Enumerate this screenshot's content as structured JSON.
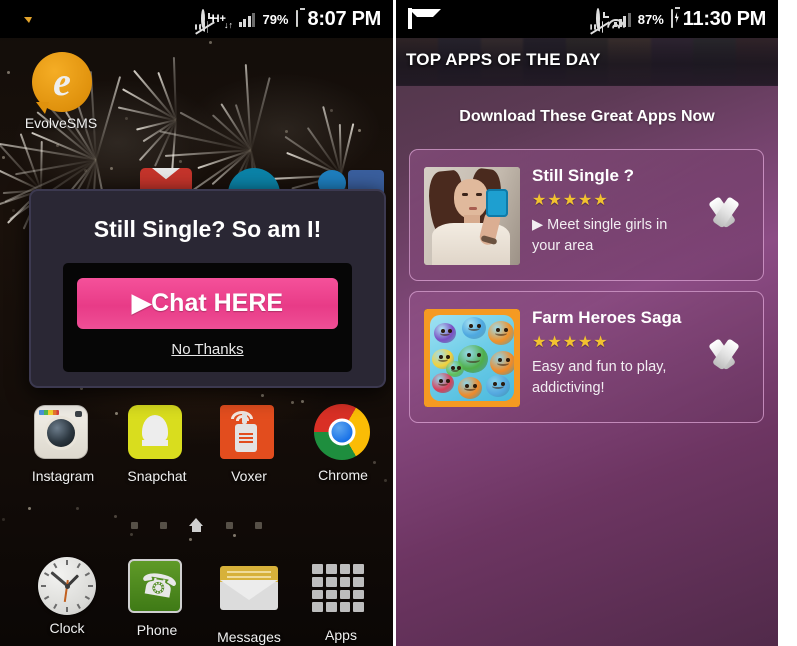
{
  "left_phone": {
    "statusbar": {
      "icons_left": [
        "snapchat-ghost-icon",
        "chat-bubble-icon"
      ],
      "icons_right": [
        "vibrate-mute-icon",
        "alarm-icon",
        "hplus-data-icon",
        "signal-bars-icon"
      ],
      "data_label": "H+",
      "data_arrows": "↓↑",
      "battery_percent": "79%",
      "time": "8:07 PM"
    },
    "home_icons": [
      {
        "label": "EvolveSMS",
        "icon": "evolvesms-icon"
      },
      {
        "label": "Instagram",
        "icon": "instagram-icon"
      },
      {
        "label": "Snapchat",
        "icon": "snapchat-icon"
      },
      {
        "label": "Voxer",
        "icon": "voxer-icon"
      },
      {
        "label": "Chrome",
        "icon": "chrome-icon"
      }
    ],
    "dock": [
      {
        "label": "Clock",
        "icon": "clock-icon"
      },
      {
        "label": "Phone",
        "icon": "phone-icon"
      },
      {
        "label": "Messages",
        "icon": "messages-icon"
      },
      {
        "label": "Apps",
        "icon": "apps-grid-icon"
      }
    ],
    "page_indicator": {
      "pages": 5,
      "current": 3,
      "home_icon": "home-icon"
    },
    "dialog": {
      "title": "Still Single? So am I!",
      "primary_button": "▶Chat HERE",
      "dismiss_link": "No Thanks",
      "accent_color": "#ef4f96",
      "panel_color": "#2a2734"
    }
  },
  "right_phone": {
    "statusbar": {
      "icons_left": [
        "envelope-icon",
        "circle-q-icon"
      ],
      "icons_right": [
        "vibrate-mute-icon",
        "alarm-icon",
        "wifi-icon",
        "signal-bars-icon"
      ],
      "battery_percent": "87%",
      "battery_state": "charging",
      "time": "11:30 PM"
    },
    "ad": {
      "header_title": "TOP APPS OF THE DAY",
      "close_icon": "close-icon",
      "subtitle": "Download These Great Apps Now",
      "accent_color": "#8c4c85",
      "cards": [
        {
          "title": "Still Single ?",
          "rating": "★★★★★",
          "rating_value": 5,
          "description": "▶ Meet single girls in your area",
          "thumb": "selfie-photo-thumb",
          "chevron": "chevron-down-icon"
        },
        {
          "title": "Farm Heroes Saga",
          "rating": "★★★★★",
          "rating_value": 5,
          "description": "Easy and fun to play, addictiving!",
          "thumb": "farm-heroes-icon-thumb",
          "chevron": "chevron-down-icon"
        }
      ]
    }
  }
}
